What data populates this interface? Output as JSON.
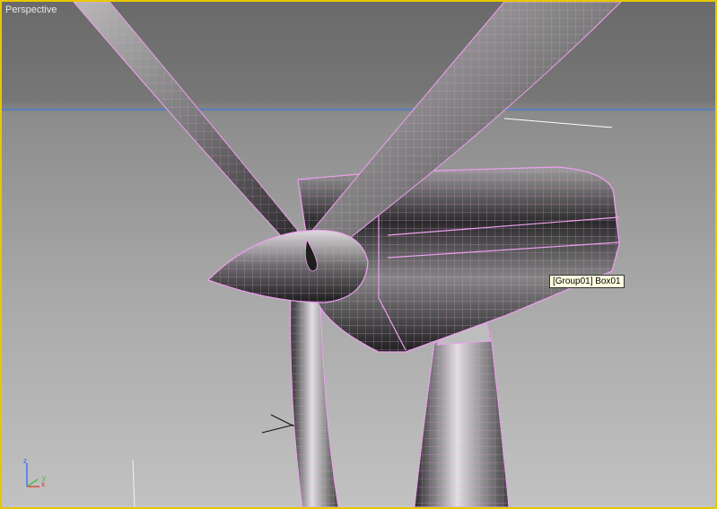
{
  "viewport": {
    "label": "Perspective",
    "tooltip": "[Group01] Box01",
    "border_color": "#e6c800",
    "wire_color": "#f0a0f0",
    "horizon_color": "#4a7fd0"
  },
  "gizmo": {
    "x_label": "x",
    "y_label": "y",
    "z_label": "z",
    "x_color": "#e03030",
    "y_color": "#30c030",
    "z_color": "#3060ff"
  }
}
